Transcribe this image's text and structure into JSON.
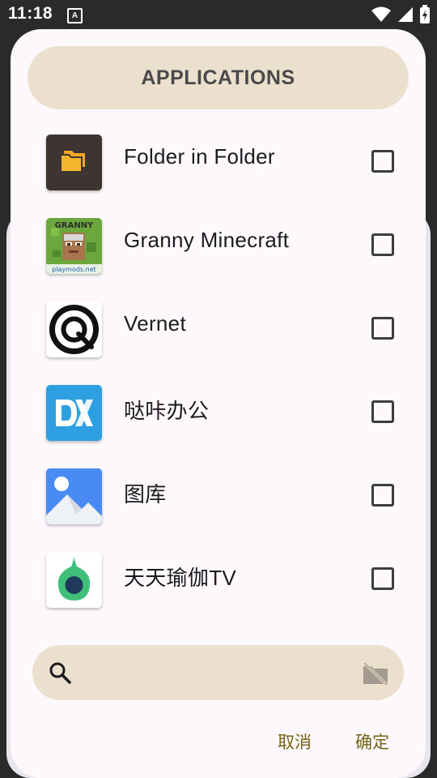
{
  "status_bar": {
    "time": "11:18",
    "notification_badge": "A",
    "icons": [
      "wifi-icon",
      "signal-icon",
      "battery-charging-icon"
    ]
  },
  "dialog": {
    "title": "APPLICATIONS",
    "apps": [
      {
        "label": "Folder in Folder",
        "icon": "folder-app-icon",
        "checked": false
      },
      {
        "label": "Granny Minecraft",
        "icon": "granny-minecraft-app-icon",
        "checked": false,
        "icon_caption_top": "GRANNY",
        "icon_caption_bottom": "playmods.net"
      },
      {
        "label": "Vernet",
        "icon": "vernet-app-icon",
        "checked": false
      },
      {
        "label": "哒咔办公",
        "icon": "dk-office-app-icon",
        "checked": false
      },
      {
        "label": "图库",
        "icon": "gallery-app-icon",
        "checked": false
      },
      {
        "label": "天天瑜伽TV",
        "icon": "yoga-tv-app-icon",
        "checked": false
      }
    ],
    "search": {
      "placeholder": "",
      "value": ""
    },
    "actions": {
      "cancel_label": "取消",
      "ok_label": "确定"
    }
  },
  "colors": {
    "header_bg": "#ebe0cd",
    "dialog_bg": "#fdf8fb",
    "accent_text": "#76621a"
  }
}
